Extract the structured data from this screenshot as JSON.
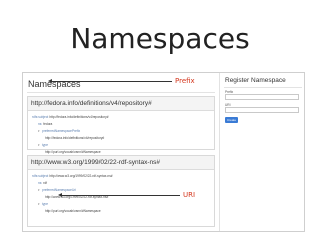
{
  "slide": {
    "title": "Namespaces"
  },
  "namespaces_panel": {
    "title": "Namespaces",
    "entries": [
      {
        "uri": "http://fedora.info/definitions/v4/repository#",
        "rows": [
          {
            "label": "rdfs:subject",
            "value": "http://fedora.info/definitions/v4/repository#"
          },
          {
            "label": "ns:",
            "value": "fedora"
          },
          {
            "label": "preferredNamespacePrefix",
            "value": ""
          },
          {
            "label": "",
            "value": "http://fedora.info/definitions/v4/repository#"
          },
          {
            "label": "type",
            "value": ""
          },
          {
            "label": "",
            "value": "http://purl.org/vocab/vann/#Namespace"
          }
        ],
        "annotation": "Prefix"
      },
      {
        "uri": "http://www.w3.org/1999/02/22-rdf-syntax-ns#",
        "rows": [
          {
            "label": "rdfs:subject",
            "value": "http://www.w3.org/1999/02/22-rdf-syntax-ns#"
          },
          {
            "label": "ns:",
            "value": "rdf"
          },
          {
            "label": "preferredNamespaceUri",
            "value": ""
          },
          {
            "label": "",
            "value": "http://www.w3.org/1999/02/22-rdf-syntax-ns#"
          },
          {
            "label": "type",
            "value": ""
          },
          {
            "label": "",
            "value": "http://purl.org/vocab/vann/#Namespace"
          }
        ],
        "annotation": "URI"
      }
    ]
  },
  "register_panel": {
    "title": "Register Namespace",
    "prefix_label": "Prefix",
    "uri_label": "URI",
    "create_label": "Create"
  },
  "colors": {
    "annotation": "#d4351c",
    "button": "#3a7bd5",
    "link_label": "#5b7fb0"
  },
  "icons": {
    "arrow": "left-arrow-icon",
    "tree_toggle": "triangle-icon"
  }
}
